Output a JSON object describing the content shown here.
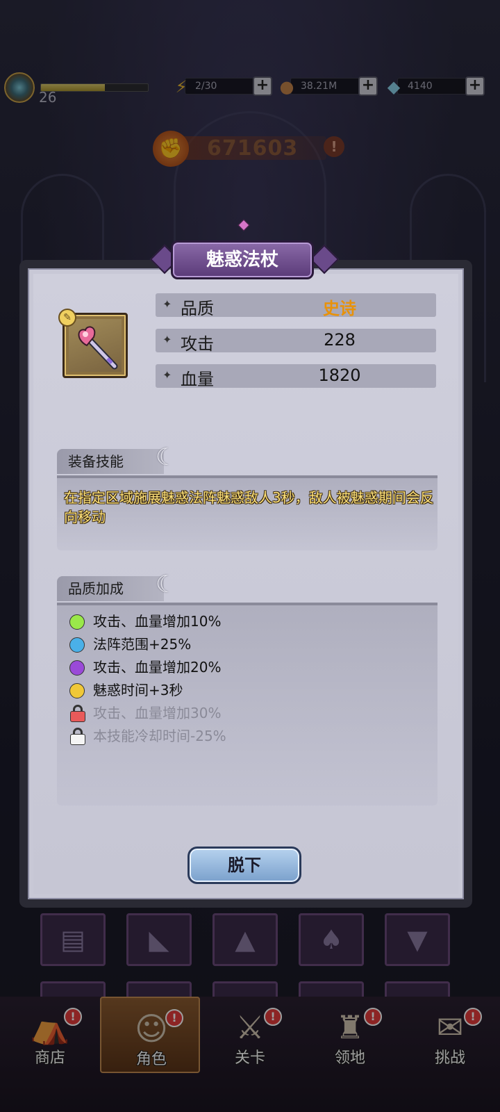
{
  "player": {
    "level": "26",
    "xp_fraction": 0.6
  },
  "resources": [
    {
      "icon": "lightning-icon",
      "glyph": "⚡",
      "value": "2/30",
      "color": "#e8b830"
    },
    {
      "icon": "coin-icon",
      "glyph": "●",
      "value": "38.21M",
      "color": "#c0824a"
    },
    {
      "icon": "diamond-icon",
      "glyph": "◆",
      "value": "4140",
      "color": "#8ad0e8"
    }
  ],
  "power": {
    "value": "671603"
  },
  "equipment": {
    "name": "魅惑法杖",
    "stats": [
      {
        "label": "品质",
        "value": "史诗",
        "highlight": true
      },
      {
        "label": "攻击",
        "value": "228"
      },
      {
        "label": "血量",
        "value": "1820"
      }
    ],
    "skill_section": {
      "title": "装备技能",
      "text": "在指定区域施展魅惑法阵魅惑敌人3秒，敌人被魅惑期间会反向移动"
    },
    "bonus_section": {
      "title": "品质加成",
      "items": [
        {
          "text": "攻击、血量增加10%",
          "marker": "dot",
          "color": "#9ae84a",
          "locked": false
        },
        {
          "text": "法阵范围+25%",
          "marker": "dot",
          "color": "#4ab0e8",
          "locked": false
        },
        {
          "text": "攻击、血量增加20%",
          "marker": "dot",
          "color": "#9a4ad8",
          "locked": false
        },
        {
          "text": "魅惑时间+3秒",
          "marker": "dot",
          "color": "#f0c838",
          "locked": false
        },
        {
          "text": "攻击、血量增加30%",
          "marker": "lock",
          "color": "#e85a5a",
          "locked": true
        },
        {
          "text": "本技能冷却时间-25%",
          "marker": "lock",
          "color": "#f4f4f4",
          "locked": true
        }
      ]
    },
    "take_off_label": "脱下"
  },
  "nav": [
    {
      "label": "商店",
      "icon": "shop-icon",
      "glyph": "⛺",
      "alert": true,
      "active": false
    },
    {
      "label": "角色",
      "icon": "character-icon",
      "glyph": "☺",
      "alert": true,
      "active": true
    },
    {
      "label": "关卡",
      "icon": "crossed-swords-icon",
      "glyph": "⚔",
      "alert": true,
      "active": false
    },
    {
      "label": "领地",
      "icon": "castle-icon",
      "glyph": "♜",
      "alert": true,
      "active": false
    },
    {
      "label": "挑战",
      "icon": "scroll-map-icon",
      "glyph": "✉",
      "alert": true,
      "active": false
    }
  ]
}
